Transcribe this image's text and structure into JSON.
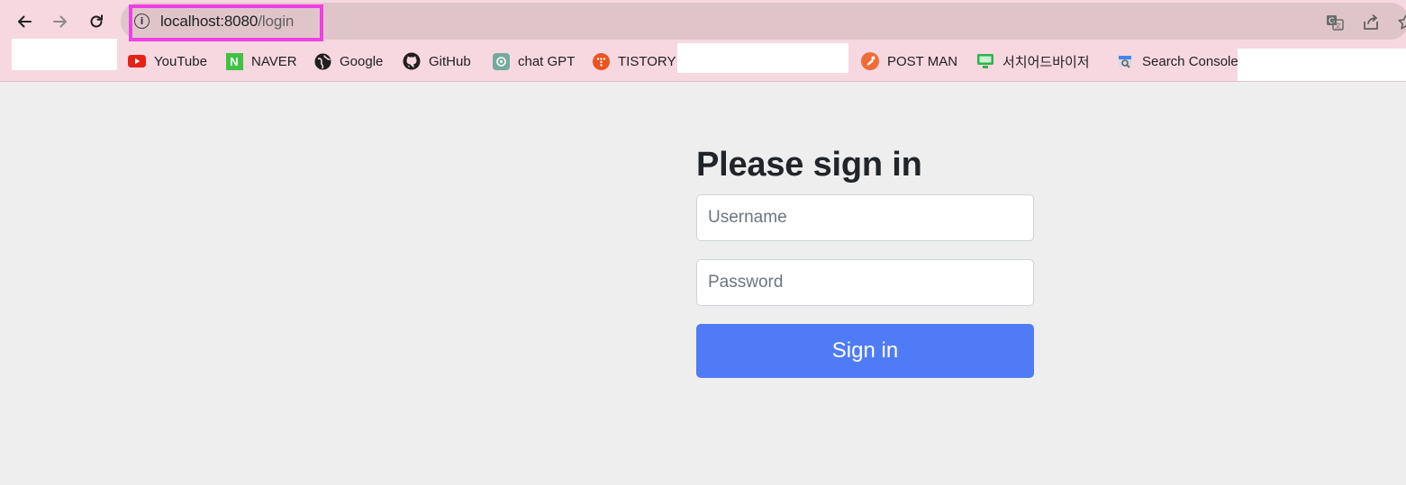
{
  "browser": {
    "url_host": "localhost:8080",
    "url_path": "/login",
    "highlight_color": "#ef3fe6",
    "toolbar_color": "#f7d7e0",
    "icons": {
      "back": "arrow-left-icon",
      "forward": "arrow-right-icon",
      "reload": "reload-icon",
      "site_info": "info-icon",
      "info_glyph": "i",
      "translate": "translate-icon",
      "share": "share-icon",
      "bookmark": "star-icon"
    }
  },
  "bookmarks": [
    {
      "label": "YouTube",
      "icon": "youtube-icon"
    },
    {
      "label": "NAVER",
      "icon": "naver-icon",
      "glyph": "N"
    },
    {
      "label": "Google",
      "icon": "globe-icon"
    },
    {
      "label": "GitHub",
      "icon": "github-icon"
    },
    {
      "label": "chat GPT",
      "icon": "chatgpt-icon"
    },
    {
      "label": "TISTORY",
      "icon": "tistory-icon"
    },
    {
      "label": "POST MAN",
      "icon": "postman-icon"
    },
    {
      "label": "서치어드바이저",
      "icon": "search-advisor-icon"
    },
    {
      "label": "Search Console",
      "icon": "search-console-icon"
    }
  ],
  "login": {
    "heading": "Please sign in",
    "username_placeholder": "Username",
    "password_placeholder": "Password",
    "submit_label": "Sign in",
    "accent_color": "#4f7cf6"
  }
}
